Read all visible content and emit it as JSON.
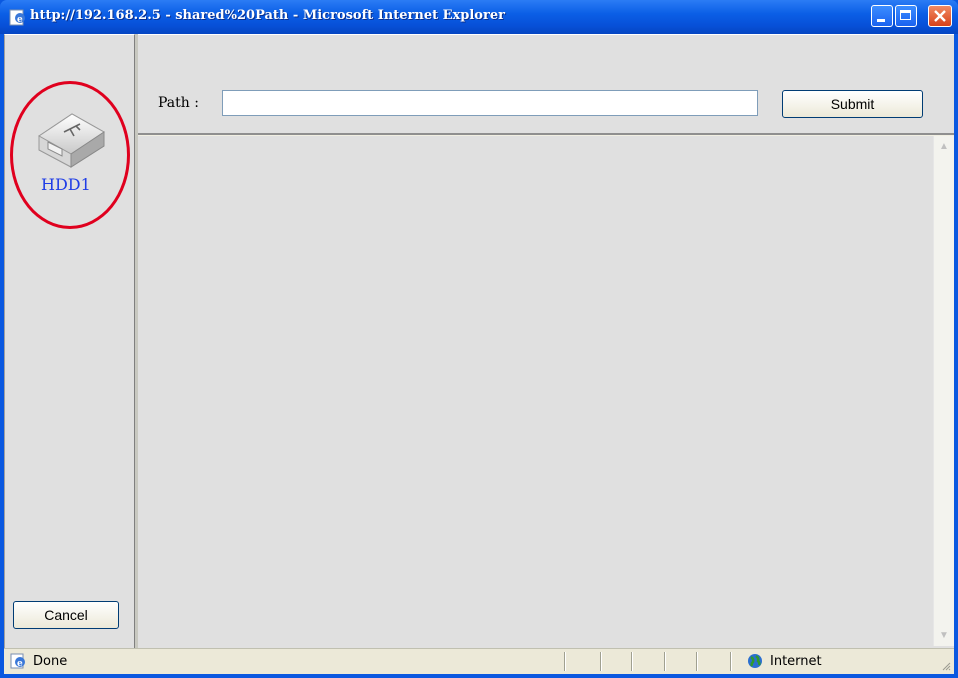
{
  "window": {
    "title": "http://192.168.2.5 - shared%20Path - Microsoft Internet Explorer",
    "title_icon": "ie-page-icon",
    "controls": [
      "minimize",
      "maximize",
      "close"
    ]
  },
  "sidebar": {
    "drive_icon": "usb-drive-icon",
    "drive_label": "HDD1",
    "cancel_label": "Cancel"
  },
  "toolbar": {
    "path_label": "Path :",
    "path_value": "",
    "submit_label": "Submit"
  },
  "statusbar": {
    "status_text": "Done",
    "zone_text": "Internet"
  },
  "colors": {
    "titlebar": "#0b5fe6",
    "pane_bg": "#e0e0e0",
    "link_blue": "#1f3de6",
    "annotation_red": "#e0001e"
  }
}
